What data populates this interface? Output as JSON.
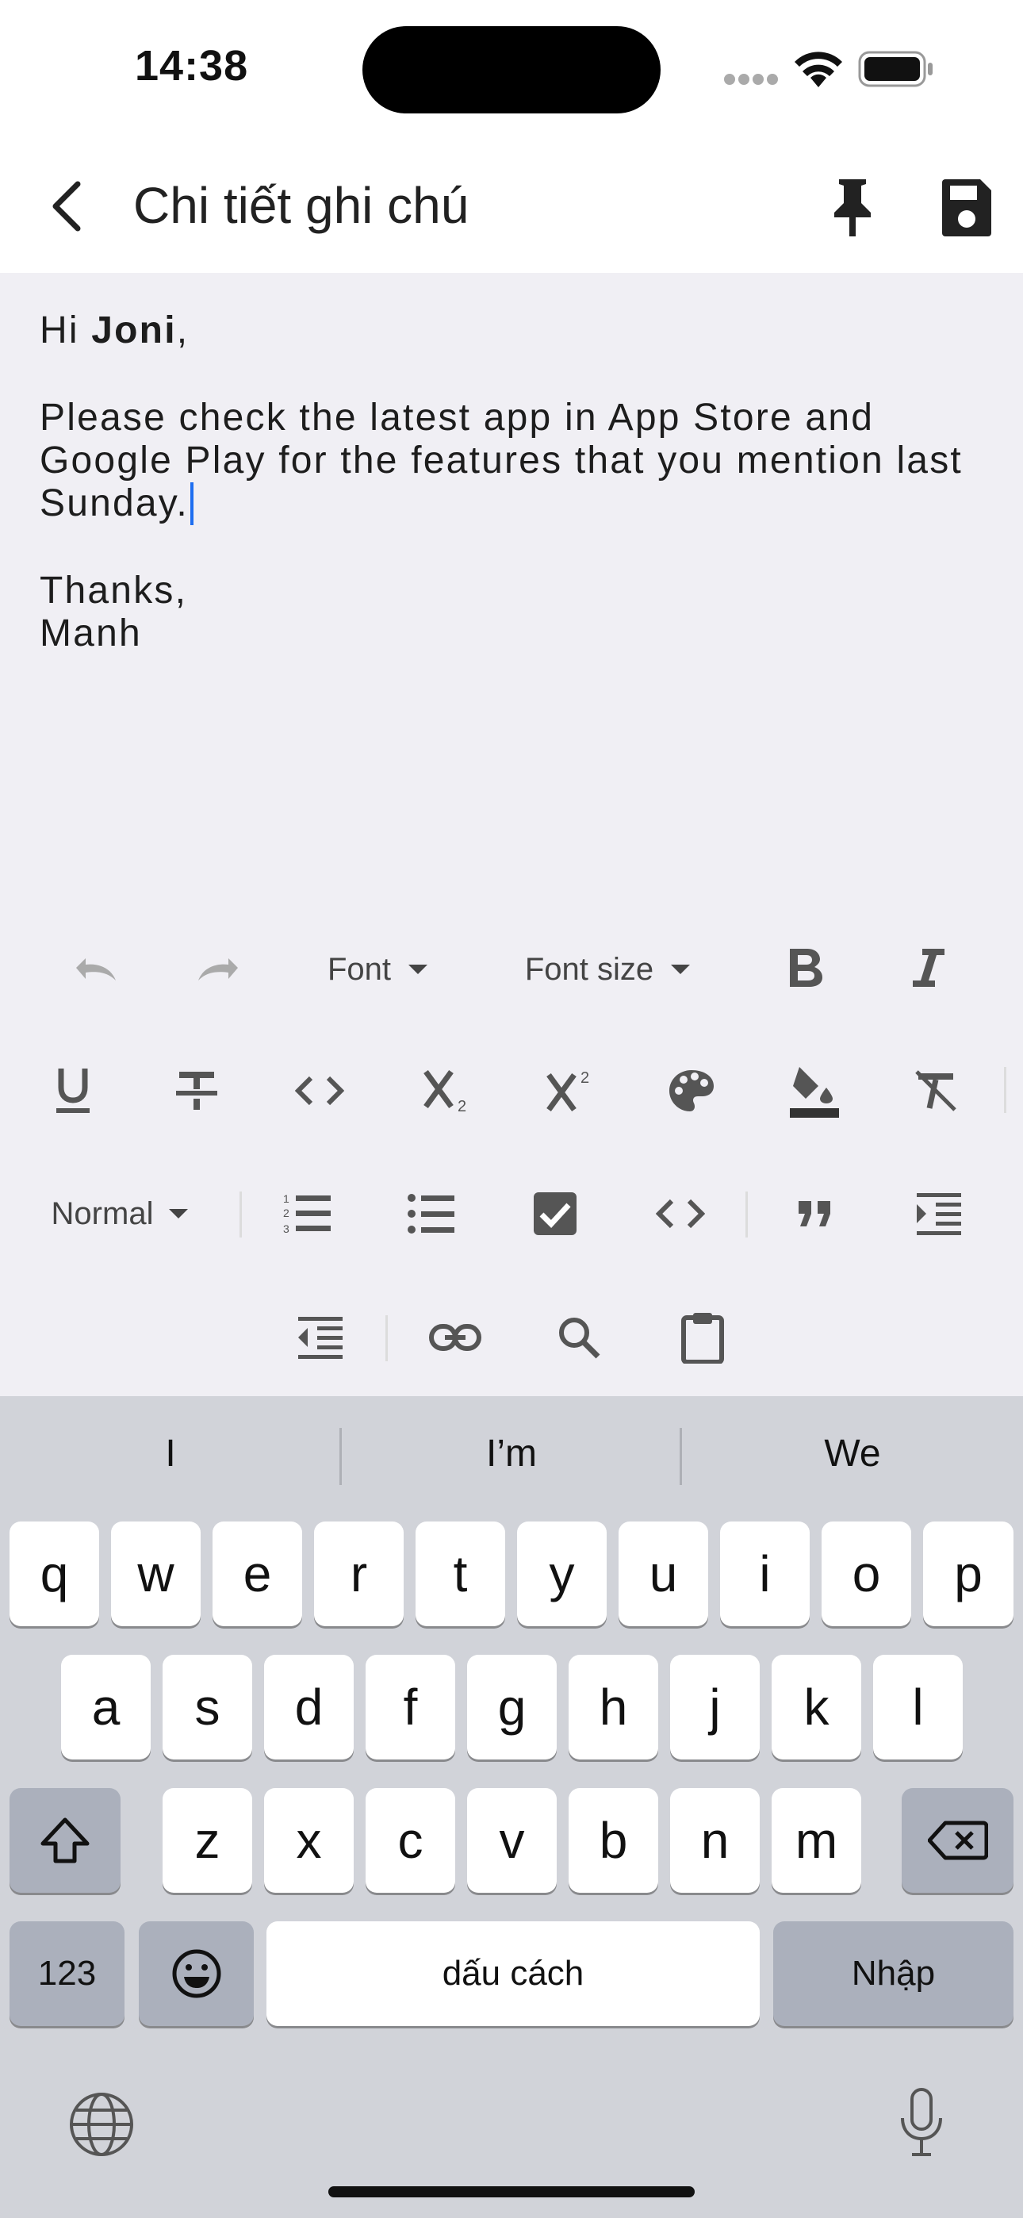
{
  "status_bar": {
    "time": "14:38"
  },
  "app_bar": {
    "title": "Chi tiết ghi chú",
    "back_icon": "chevron-left-icon",
    "pin_icon": "pin-icon",
    "save_icon": "floppy-disk-icon"
  },
  "note": {
    "greeting_prefix": "Hi ",
    "greeting_name": "Joni",
    "greeting_suffix": ",",
    "body_line1": "Please check the latest app in App Store and",
    "body_line2": "Google Play for the features that you mention last",
    "body_line3": "Sunday.",
    "closing": "Thanks,",
    "signature": "Manh"
  },
  "toolbar": {
    "font_label": "Font",
    "font_size_label": "Font size",
    "heading_style_label": "Normal",
    "icons": [
      "undo-icon",
      "redo-icon",
      "bold-icon",
      "italic-icon",
      "underline-icon",
      "strikethrough-icon",
      "inline-code-icon",
      "subscript-icon",
      "superscript-icon",
      "text-color-icon",
      "background-color-icon",
      "clear-format-icon",
      "numbered-list-icon",
      "bulleted-list-icon",
      "checkbox-list-icon",
      "code-block-icon",
      "quote-icon",
      "indent-increase-icon",
      "indent-decrease-icon",
      "link-icon",
      "search-icon",
      "clipboard-icon"
    ]
  },
  "keyboard": {
    "suggestions": [
      "I",
      "I’m",
      "We"
    ],
    "row1": [
      "q",
      "w",
      "e",
      "r",
      "t",
      "y",
      "u",
      "i",
      "o",
      "p"
    ],
    "row2": [
      "a",
      "s",
      "d",
      "f",
      "g",
      "h",
      "j",
      "k",
      "l"
    ],
    "row3": [
      "z",
      "x",
      "c",
      "v",
      "b",
      "n",
      "m"
    ],
    "numbers_label": "123",
    "space_label": "dấu cách",
    "return_label": "Nhập"
  },
  "colors": {
    "caret": "#1e6ef0",
    "editor_bg": "#f0eff4",
    "keyboard_bg": "#d1d3d9"
  }
}
